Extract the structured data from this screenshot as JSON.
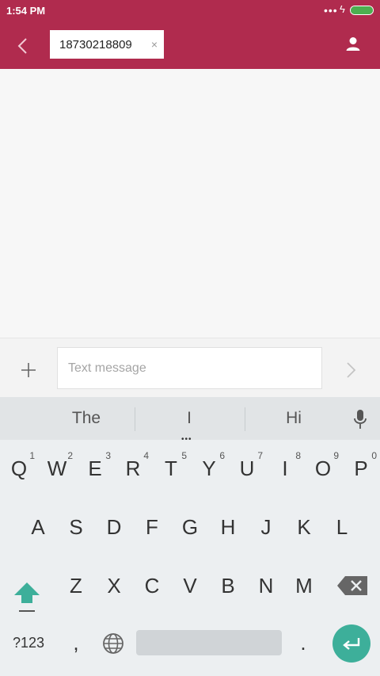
{
  "status_bar": {
    "time": "1:54 PM",
    "signal": "•••",
    "charging": "ϟ",
    "battery_level": 1.0
  },
  "app_bar": {
    "recipient": "18730218809",
    "remove_glyph": "×"
  },
  "composer": {
    "placeholder": "Text message"
  },
  "keyboard": {
    "suggestions": [
      "The",
      "I",
      "Hi"
    ],
    "more_suggestions": "•••",
    "row1": [
      {
        "label": "Q",
        "hint": "1"
      },
      {
        "label": "W",
        "hint": "2"
      },
      {
        "label": "E",
        "hint": "3"
      },
      {
        "label": "R",
        "hint": "4"
      },
      {
        "label": "T",
        "hint": "5"
      },
      {
        "label": "Y",
        "hint": "6"
      },
      {
        "label": "U",
        "hint": "7"
      },
      {
        "label": "I",
        "hint": "8"
      },
      {
        "label": "O",
        "hint": "9"
      },
      {
        "label": "P",
        "hint": "0"
      }
    ],
    "row2": [
      "A",
      "S",
      "D",
      "F",
      "G",
      "H",
      "J",
      "K",
      "L"
    ],
    "row3": [
      "Z",
      "X",
      "C",
      "V",
      "B",
      "N",
      "M"
    ],
    "symbols_label": "?123",
    "comma": ",",
    "period": ".",
    "accent_color": "#3daf9a"
  },
  "colors": {
    "app_bar": "#b02b4e",
    "battery": "#4caf50"
  }
}
